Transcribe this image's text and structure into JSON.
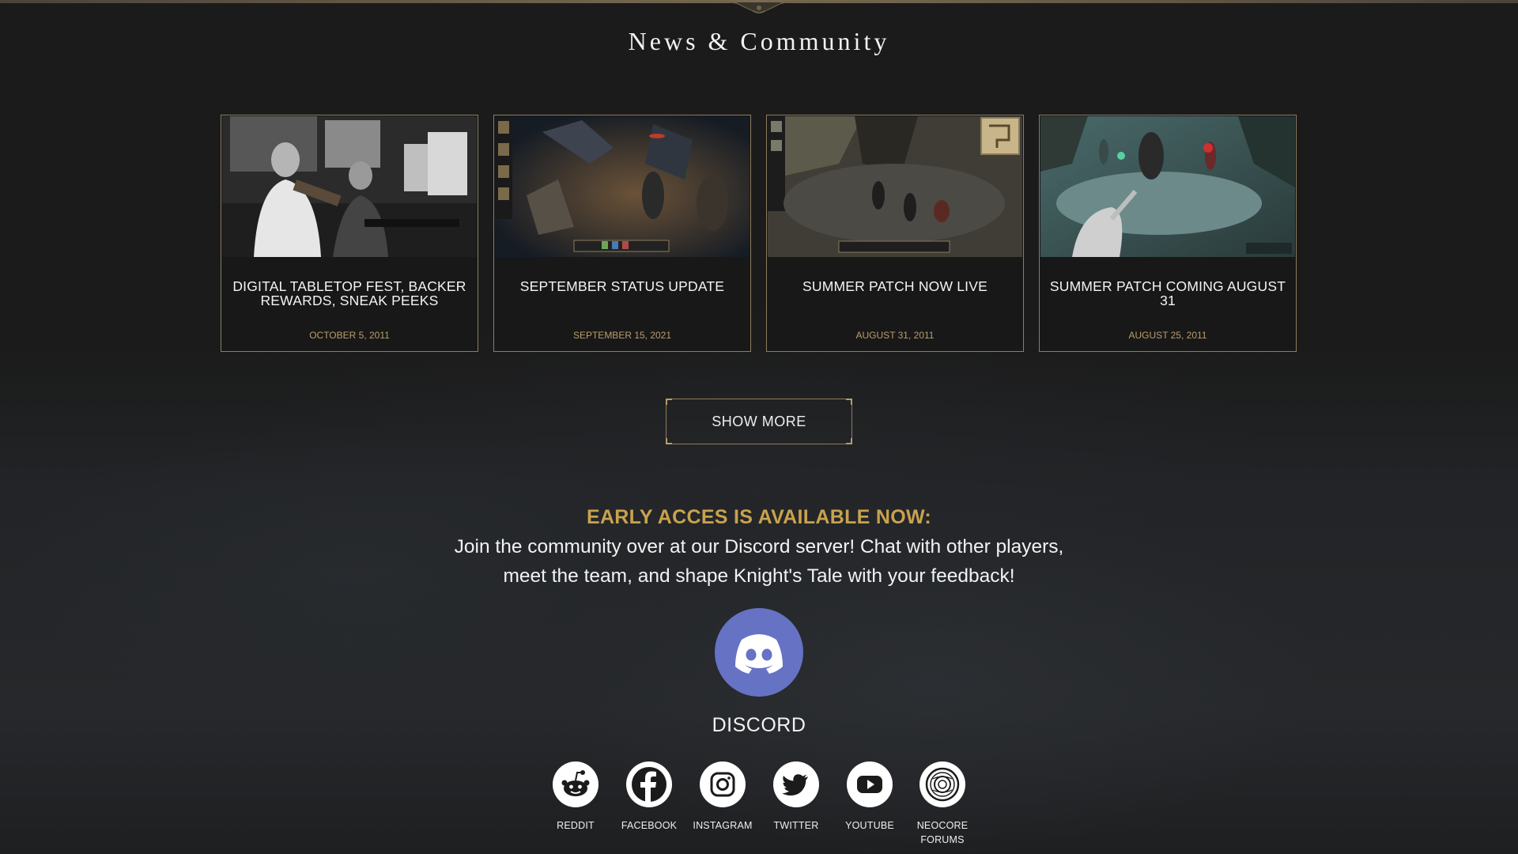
{
  "section": {
    "title": "News & Community"
  },
  "news": [
    {
      "title": "DIGITAL TABLETOP FEST, BACKER REWARDS, SNEAK PEEKS",
      "date": "OCTOBER 5, 2011",
      "image_icon": "studio-musicians-photo"
    },
    {
      "title": "SEPTEMBER STATUS UPDATE",
      "date": "SEPTEMBER 15, 2021",
      "image_icon": "game-screenshot"
    },
    {
      "title": "SUMMER PATCH NOW LIVE",
      "date": "AUGUST 31, 2011",
      "image_icon": "game-screenshot"
    },
    {
      "title": "SUMMER PATCH COMING AUGUST 31",
      "date": "AUGUST 25, 2011",
      "image_icon": "game-screenshot"
    }
  ],
  "show_more_label": "SHOW MORE",
  "community": {
    "headline": "EARLY ACCES IS AVAILABLE NOW:",
    "line1": "Join the community over at our Discord server! Chat with other players,",
    "line2": "meet the team, and shape Knight's Tale with your feedback!"
  },
  "discord": {
    "label": "DISCORD",
    "icon": "discord-icon",
    "color": "#6672c4"
  },
  "socials": [
    {
      "label": "REDDIT",
      "icon": "reddit-icon"
    },
    {
      "label": "FACEBOOK",
      "icon": "facebook-icon"
    },
    {
      "label": "INSTAGRAM",
      "icon": "instagram-icon"
    },
    {
      "label": "TWITTER",
      "icon": "twitter-icon"
    },
    {
      "label": "YOUTUBE",
      "icon": "youtube-icon"
    },
    {
      "label": "NEOCORE\nFORUMS",
      "icon": "neocore-forums-icon"
    }
  ],
  "colors": {
    "accent_gold": "#c9a24e",
    "date_gold": "#b89e6c",
    "border": "#8c7d5e",
    "background": "#1b1b1b"
  }
}
